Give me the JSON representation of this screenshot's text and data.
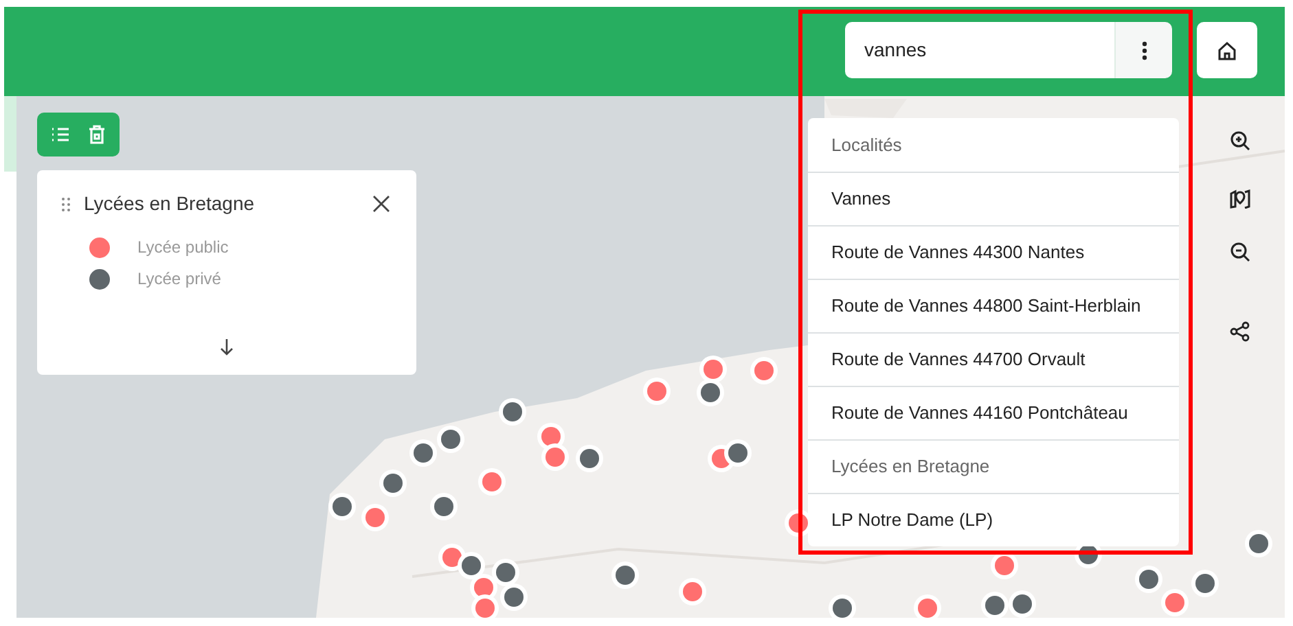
{
  "search": {
    "value": "vannes"
  },
  "legend": {
    "title": "Lycées en Bretagne",
    "items": [
      {
        "label": "Lycée public",
        "color": "#ff6f6f"
      },
      {
        "label": "Lycée privé",
        "color": "#5f676b"
      }
    ]
  },
  "results": [
    {
      "kind": "header",
      "label": "Localités"
    },
    {
      "kind": "item",
      "label": "Vannes"
    },
    {
      "kind": "item",
      "label": "Route de Vannes 44300 Nantes"
    },
    {
      "kind": "item",
      "label": "Route de Vannes 44800 Saint-Herblain"
    },
    {
      "kind": "item",
      "label": "Route de Vannes 44700 Orvault"
    },
    {
      "kind": "item",
      "label": "Route de Vannes 44160 Pontchâteau"
    },
    {
      "kind": "header",
      "label": "Lycées en Bretagne"
    },
    {
      "kind": "item",
      "label": "LP Notre Dame (LP)"
    }
  ]
}
